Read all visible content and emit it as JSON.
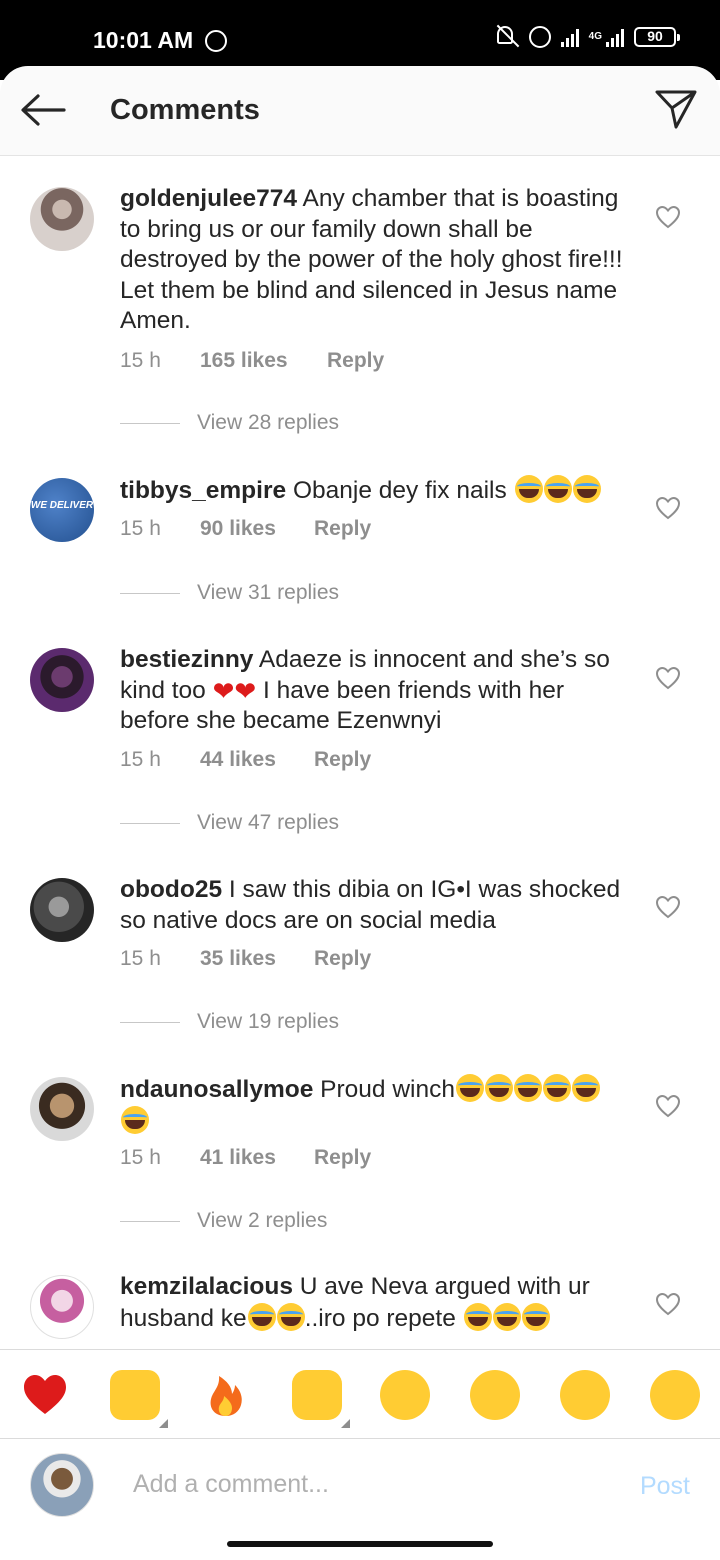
{
  "status_bar": {
    "time": "10:01 AM",
    "network": "4G",
    "battery": "90"
  },
  "header": {
    "title": "Comments"
  },
  "comments": [
    {
      "user": "goldenjulee774",
      "text": "Any chamber that is boasting to bring us or our family down shall be destroyed by the power of the holy ghost fire!!! Let them be blind and silenced in Jesus name Amen.",
      "time": "15 h",
      "likes": "165 likes",
      "reply": "Reply",
      "view_replies": "View 28 replies"
    },
    {
      "user": "tibbys_empire",
      "text": "Obanje dey fix nails",
      "time": "15 h",
      "likes": "90 likes",
      "reply": "Reply",
      "view_replies": "View 31 replies"
    },
    {
      "user": "bestiezinny",
      "text": "Adaeze is innocent and she’s so kind too",
      "text2": "I have been friends with her before she became Ezenwnyi",
      "time": "15 h",
      "likes": "44 likes",
      "reply": "Reply",
      "view_replies": "View 47 replies"
    },
    {
      "user": "obodo25",
      "text": "I saw this dibia on IG•I was shocked so native docs are on social media",
      "time": "15 h",
      "likes": "35 likes",
      "reply": "Reply",
      "view_replies": "View 19 replies"
    },
    {
      "user": "ndaunosallymoe",
      "text": "Proud winch",
      "time": "15 h",
      "likes": "41 likes",
      "reply": "Reply",
      "view_replies": "View 2 replies"
    },
    {
      "user": "kemzilalacious",
      "text": "U ave Neva argued with ur husband ke",
      "text2": "..iro po repete"
    }
  ],
  "avatar_logo_text": "WE DELIVER",
  "reactions": [
    "red-heart",
    "raising-hands",
    "fire",
    "clapping-hands",
    "crying-face",
    "heart-eyes",
    "surprised-face",
    "laughing-tears"
  ],
  "composer": {
    "placeholder": "Add a comment...",
    "post_label": "Post"
  },
  "colors": {
    "link_blue": "#b3dbff",
    "meta_grey": "#8e8e8e",
    "text": "#262626"
  }
}
